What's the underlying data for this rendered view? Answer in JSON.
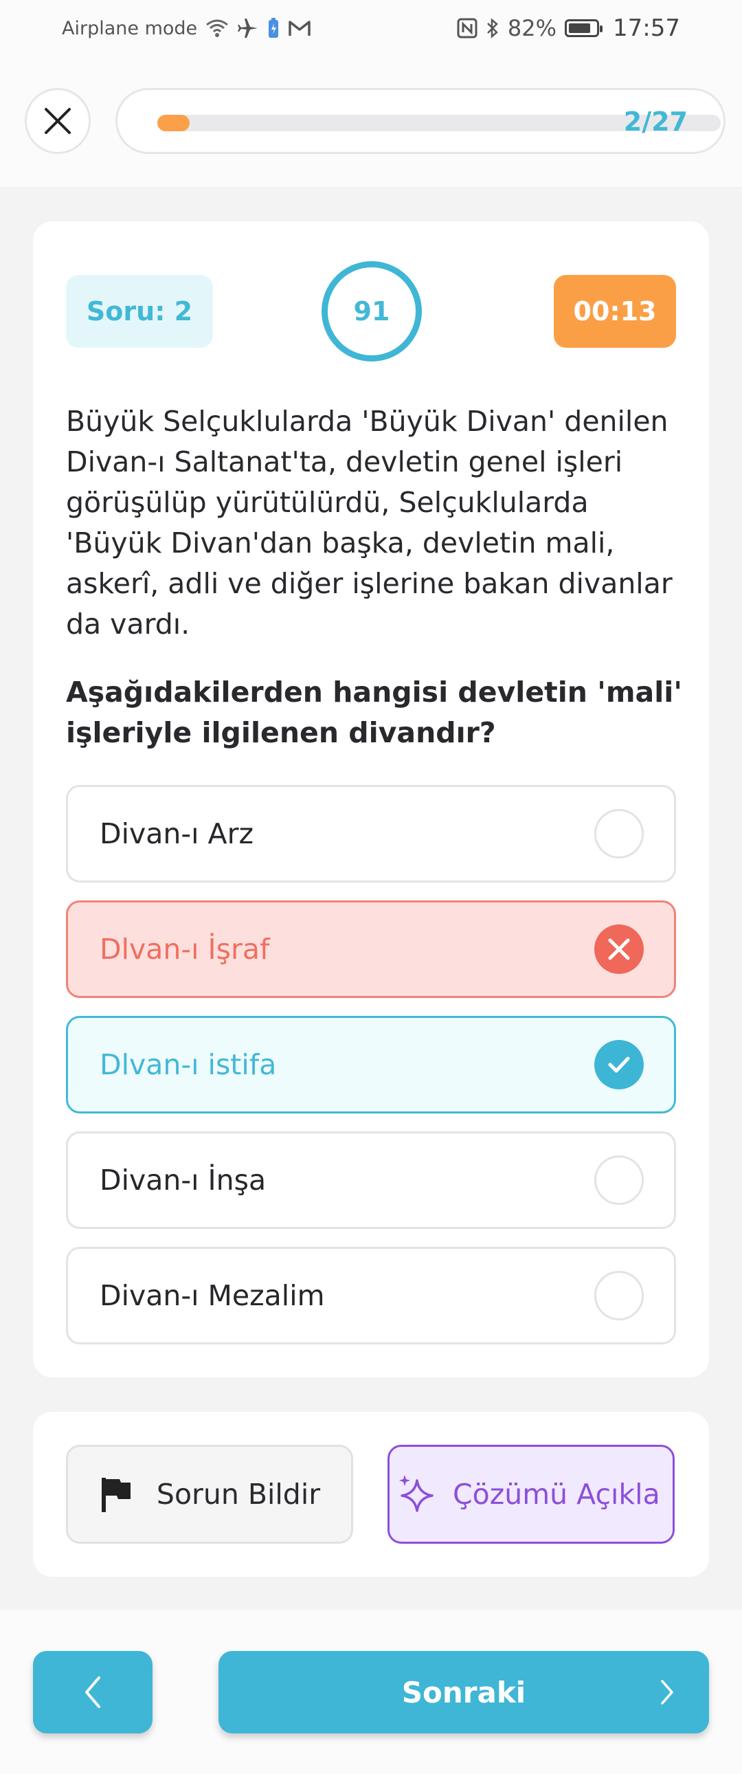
{
  "status_bar": {
    "mode": "Airplane mode",
    "battery": "82%",
    "battery_level": 0.82,
    "time": "17:57",
    "icons": [
      "wifi-icon",
      "airplane-icon",
      "battery-saver-icon",
      "gmail-icon",
      "nfc-icon",
      "bluetooth-icon",
      "battery-icon"
    ]
  },
  "header": {
    "progress_text": "2/27",
    "progress_fraction": 0.074,
    "close_icon": "close-icon"
  },
  "question": {
    "number_label": "Soru: 2",
    "score": "91",
    "timer": "00:13",
    "text": "Büyük Selçuklularda 'Büyük Divan' denilen Divan-ı Saltanat'ta, devletin genel işleri görüşülüp yürütülürdü, Selçuklularda 'Büyük Divan'dan başka, devletin mali, askerî, adli ve diğer işlerine bakan divanlar da vardı.",
    "prompt": "Aşağıdakilerden hangisi devletin 'mali' işleriyle ilgilenen divandır?"
  },
  "options": [
    {
      "label": "Divan-ı Arz",
      "state": "default"
    },
    {
      "label": "Dlvan-ı İşraf",
      "state": "wrong"
    },
    {
      "label": "Dlvan-ı istifa",
      "state": "correct"
    },
    {
      "label": "Divan-ı İnşa",
      "state": "default"
    },
    {
      "label": "Divan-ı Mezalim",
      "state": "default"
    }
  ],
  "actions": {
    "report_label": "Sorun Bildir",
    "explain_label": "Çözümü Açıkla"
  },
  "nav": {
    "next_label": "Sonraki"
  },
  "colors": {
    "accent": "#3fb6d5",
    "warning": "#fb9f47",
    "error": "#ef6859",
    "purple": "#8c4fd9"
  }
}
